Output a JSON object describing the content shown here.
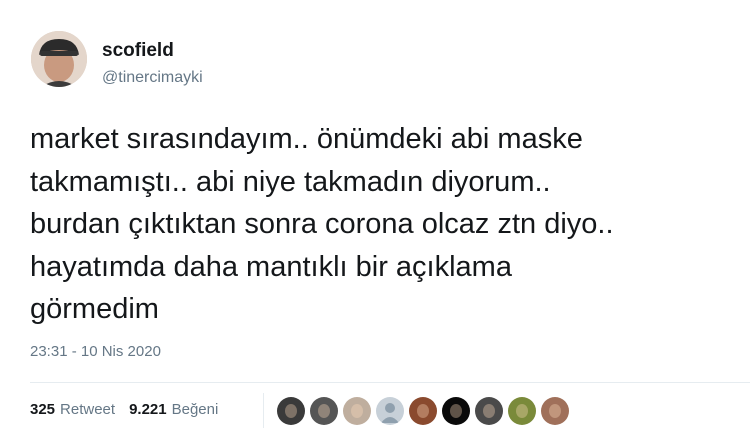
{
  "user": {
    "display_name": "scofield",
    "handle": "@tinercimayki",
    "avatar_icon": "profile-photo"
  },
  "tweet": {
    "text_lines": [
      "market sırasındayım.. önümdeki abi maske",
      "takmamıştı.. abi niye takmadın diyorum..",
      "burdan çıktıktan sonra corona olcaz ztn diyo..",
      "hayatımda daha mantıklı bir açıklama",
      "görmedim"
    ],
    "timestamp": "23:31 - 10 Nis 2020"
  },
  "stats": {
    "retweet_count": "325",
    "retweet_label": "Retweet",
    "like_count": "9.221",
    "like_label": "Beğeni"
  },
  "likers": [
    {
      "icon": "liker-avatar",
      "color": "#3a3a3a"
    },
    {
      "icon": "liker-avatar",
      "color": "#555555"
    },
    {
      "icon": "liker-avatar",
      "color": "#bfae9e"
    },
    {
      "icon": "default-avatar",
      "color": "#c7d0d8"
    },
    {
      "icon": "liker-avatar",
      "color": "#8a4a2e"
    },
    {
      "icon": "liker-avatar",
      "color": "#0a0a0a"
    },
    {
      "icon": "liker-avatar",
      "color": "#4a4a4a"
    },
    {
      "icon": "liker-avatar",
      "color": "#7a8a3a"
    },
    {
      "icon": "liker-avatar",
      "color": "#a0705a"
    }
  ]
}
